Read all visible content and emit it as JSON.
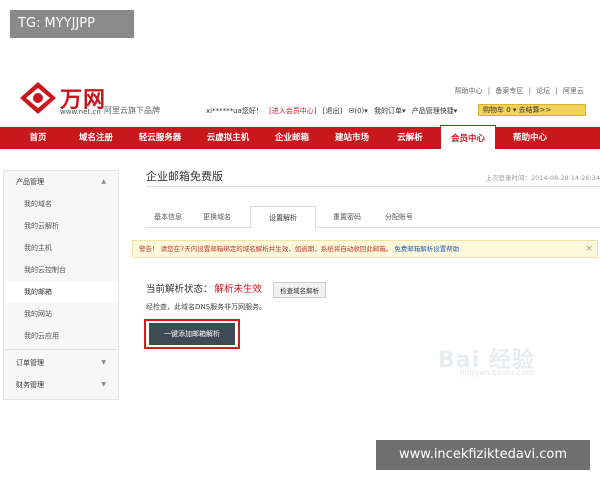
{
  "overlays": {
    "tag": "TG: MYYJJPP",
    "site": "www.incekfiziktedavi.com"
  },
  "brand": {
    "name": "万网",
    "url": "www.net.cn",
    "slogan": "阿里云旗下品牌",
    "accent": "#c9171e"
  },
  "toplinks": [
    "帮助中心",
    "|",
    "备案专区",
    "|",
    "论坛",
    "|",
    "阿里云"
  ],
  "userbar": {
    "greeting": "xi******ua您好！",
    "enter": "[进入会员中心]",
    "logout": "[退出]",
    "messages": "✉(0)▾",
    "orders": "我的订单▾",
    "tools": "产品管理快捷▾"
  },
  "cart": {
    "label": "购物车 0 ▾ 去结算>>"
  },
  "nav": [
    {
      "label": "首页",
      "active": false
    },
    {
      "label": "域名注册",
      "active": false
    },
    {
      "label": "轻云服务器",
      "active": false
    },
    {
      "label": "云虚拟主机",
      "active": false
    },
    {
      "label": "企业邮箱",
      "active": false
    },
    {
      "label": "建站市场",
      "active": false
    },
    {
      "label": "云解析",
      "active": false
    },
    {
      "label": "会员中心",
      "active": true
    },
    {
      "label": "帮助中心",
      "active": false
    }
  ],
  "sidebar": {
    "group_product": "产品管理",
    "group_caret": "▲",
    "items": [
      "我的域名",
      "我的云解析",
      "我的主机",
      "我的云控制台",
      "我的邮箱",
      "我的网站",
      "我的云应用"
    ],
    "current_index": 4,
    "group_orders": "订单管理",
    "group_finance": "财务管理",
    "collapsed_caret": "▼"
  },
  "main": {
    "title": "企业邮箱免费版",
    "last_login": "上次登录时间：2014-08-28 14:26:34",
    "tabs": [
      "基本信息",
      "更换域名",
      "设置解析",
      "重置密码",
      "分配账号"
    ],
    "active_tab": 2,
    "alert_text": "警告！ 请您在7天内设置邮箱绑定的域名解析并生效，如逾期，系统将自动收回此邮箱。",
    "alert_link": "免费邮箱解析设置帮助",
    "alert_close": "×",
    "status_label": "当前解析状态：",
    "status_value": "解析未生效",
    "check_button": "检查域名解析",
    "note": "经检查，此域名DNS服务非万网服务。",
    "action_button": "一键添加邮箱解析"
  },
  "watermark": {
    "main": "Bai 经验",
    "sub": "jingyan.baidu.com"
  }
}
